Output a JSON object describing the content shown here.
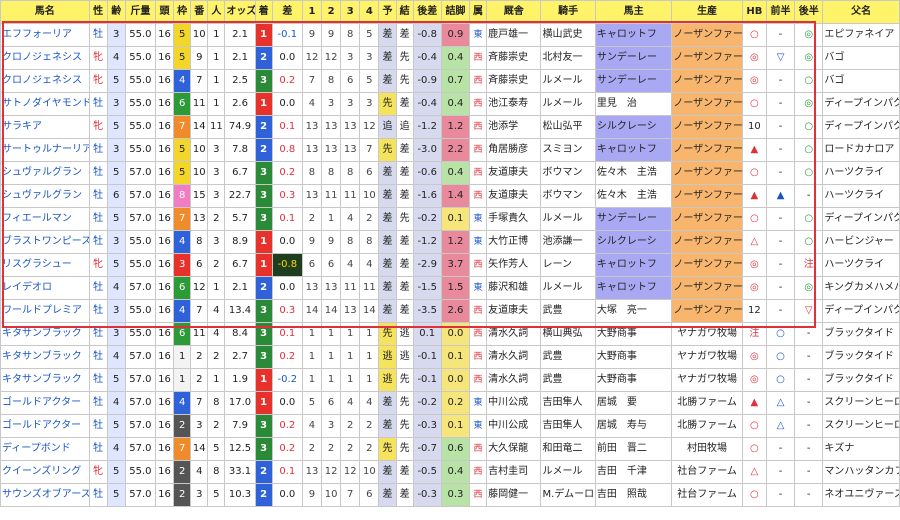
{
  "headers": [
    "馬名",
    "性",
    "齢",
    "斤量",
    "頭",
    "枠",
    "番",
    "人",
    "オッズ",
    "着",
    "差",
    "1",
    "2",
    "3",
    "4",
    "予",
    "結",
    "後差",
    "詰脚",
    "属",
    "厩舎",
    "騎手",
    "馬主",
    "生産",
    "HB",
    "前半",
    "後半",
    "父名"
  ],
  "rows": [
    [
      "エフフォーリア",
      "牡",
      "3",
      "55.0",
      "16",
      "5",
      "10",
      "1",
      "2.1",
      "1",
      "-0.1",
      "9",
      "9",
      "8",
      "5",
      "差",
      "差",
      "-0.8",
      "0.9",
      "東",
      "鹿戸雄一",
      "横山武史",
      "キャロットフ",
      "ノーザンファーム",
      "○",
      "-",
      "◎",
      "エピファネイア"
    ],
    [
      "クロノジェネシス",
      "牝",
      "4",
      "55.0",
      "16",
      "5",
      "9",
      "1",
      "2.1",
      "2",
      "0.0",
      "12",
      "12",
      "3",
      "3",
      "差",
      "先",
      "-0.4",
      "0.4",
      "西",
      "斉藤崇史",
      "北村友一",
      "サンデーレー",
      "ノーザンファーム",
      "◎",
      "▽",
      "◎",
      "バゴ"
    ],
    [
      "クロノジェネシス",
      "牝",
      "5",
      "55.0",
      "16",
      "4",
      "7",
      "1",
      "2.5",
      "3",
      "0.2",
      "7",
      "8",
      "6",
      "5",
      "差",
      "先",
      "-0.9",
      "0.7",
      "西",
      "斉藤崇史",
      "ルメール",
      "サンデーレー",
      "ノーザンファーム",
      "◎",
      "-",
      "○",
      "バゴ"
    ],
    [
      "サトノダイヤモンド",
      "牡",
      "3",
      "55.0",
      "16",
      "6",
      "11",
      "1",
      "2.6",
      "1",
      "0.0",
      "4",
      "3",
      "3",
      "3",
      "先",
      "差",
      "-0.4",
      "0.4",
      "西",
      "池江泰寿",
      "ルメール",
      "里見　治",
      "ノーザンファーム",
      "○",
      "-",
      "◎",
      "ディープインパクト"
    ],
    [
      "サラキア",
      "牝",
      "5",
      "55.0",
      "16",
      "7",
      "14",
      "11",
      "74.9",
      "2",
      "0.1",
      "13",
      "13",
      "13",
      "12",
      "追",
      "追",
      "-1.2",
      "1.2",
      "西",
      "池添学",
      "松山弘平",
      "シルクレーシ",
      "ノーザンファーム",
      "10",
      "-",
      "○",
      "ディープインパクト"
    ],
    [
      "サートゥルナーリア",
      "牡",
      "3",
      "55.0",
      "16",
      "5",
      "10",
      "3",
      "7.8",
      "2",
      "0.8",
      "13",
      "13",
      "13",
      "7",
      "先",
      "差",
      "-3.0",
      "2.2",
      "西",
      "角居勝彦",
      "スミヨン",
      "キャロットフ",
      "ノーザンファーム",
      "▲",
      "-",
      "○",
      "ロードカナロア"
    ],
    [
      "シュヴァルグラン",
      "牡",
      "5",
      "57.0",
      "16",
      "5",
      "10",
      "3",
      "6.7",
      "3",
      "0.2",
      "8",
      "8",
      "8",
      "6",
      "差",
      "差",
      "-0.6",
      "0.4",
      "西",
      "友道康夫",
      "ボウマン",
      "佐々木　主浩",
      "ノーザンファーム",
      "○",
      "-",
      "○",
      "ハーツクライ"
    ],
    [
      "シュヴァルグラン",
      "牡",
      "6",
      "57.0",
      "16",
      "8",
      "15",
      "3",
      "22.7",
      "3",
      "0.3",
      "13",
      "11",
      "11",
      "10",
      "差",
      "差",
      "-1.6",
      "1.4",
      "西",
      "友道康夫",
      "ボウマン",
      "佐々木　主浩",
      "ノーザンファーム",
      "▲",
      "▲",
      "-",
      "ハーツクライ"
    ],
    [
      "フィエールマン",
      "牡",
      "5",
      "57.0",
      "16",
      "7",
      "13",
      "2",
      "5.7",
      "3",
      "0.1",
      "2",
      "1",
      "4",
      "2",
      "差",
      "先",
      "-0.2",
      "0.1",
      "東",
      "手塚貴久",
      "ルメール",
      "サンデーレー",
      "ノーザンファーム",
      "○",
      "-",
      "○",
      "ディープインパクト"
    ],
    [
      "ブラストワンピース",
      "牡",
      "3",
      "55.0",
      "16",
      "4",
      "8",
      "3",
      "8.9",
      "1",
      "0.0",
      "9",
      "9",
      "8",
      "8",
      "差",
      "差",
      "-1.2",
      "1.2",
      "東",
      "大竹正博",
      "池添謙一",
      "シルクレーシ",
      "ノーザンファーム",
      "△",
      "-",
      "○",
      "ハービンジャー"
    ],
    [
      "リスグラシュー",
      "牝",
      "5",
      "55.0",
      "16",
      "3",
      "6",
      "2",
      "6.7",
      "1",
      "-0.8",
      "6",
      "6",
      "4",
      "4",
      "差",
      "差",
      "-2.9",
      "3.7",
      "西",
      "矢作芳人",
      "レーン",
      "キャロットフ",
      "ノーザンファーム",
      "◎",
      "-",
      "注",
      "ハーツクライ"
    ],
    [
      "レイデオロ",
      "牡",
      "4",
      "57.0",
      "16",
      "6",
      "12",
      "1",
      "2.1",
      "2",
      "0.0",
      "13",
      "13",
      "11",
      "11",
      "差",
      "差",
      "-1.5",
      "1.5",
      "東",
      "藤沢和雄",
      "ルメール",
      "キャロットフ",
      "ノーザンファーム",
      "◎",
      "-",
      "◎",
      "キングカメハメハ"
    ],
    [
      "ワールドプレミア",
      "牡",
      "3",
      "55.0",
      "16",
      "4",
      "7",
      "4",
      "13.4",
      "3",
      "0.3",
      "14",
      "14",
      "13",
      "14",
      "差",
      "差",
      "-3.5",
      "2.6",
      "西",
      "友道康夫",
      "武豊",
      "大塚　亮一",
      "ノーザンファーム",
      "12",
      "-",
      "▽",
      "ディープインパクト"
    ],
    [
      "キタサンブラック",
      "牡",
      "3",
      "55.0",
      "16",
      "6",
      "11",
      "4",
      "8.4",
      "3",
      "0.1",
      "1",
      "1",
      "1",
      "1",
      "先",
      "逃",
      "0.1",
      "0.0",
      "西",
      "清水久詞",
      "横山典弘",
      "大野商事",
      "ヤナガワ牧場",
      "注",
      "○",
      "-",
      "ブラックタイド"
    ],
    [
      "キタサンブラック",
      "牡",
      "4",
      "57.0",
      "16",
      "1",
      "2",
      "2",
      "2.7",
      "3",
      "0.2",
      "1",
      "1",
      "1",
      "1",
      "逃",
      "逃",
      "-0.1",
      "0.1",
      "西",
      "清水久詞",
      "武豊",
      "大野商事",
      "ヤナガワ牧場",
      "◎",
      "○",
      "-",
      "ブラックタイド"
    ],
    [
      "キタサンブラック",
      "牡",
      "5",
      "57.0",
      "16",
      "1",
      "2",
      "1",
      "1.9",
      "1",
      "-0.2",
      "1",
      "1",
      "1",
      "1",
      "逃",
      "先",
      "-0.1",
      "0.0",
      "西",
      "清水久詞",
      "武豊",
      "大野商事",
      "ヤナガワ牧場",
      "◎",
      "○",
      "-",
      "ブラックタイド"
    ],
    [
      "ゴールドアクター",
      "牡",
      "4",
      "57.0",
      "16",
      "4",
      "7",
      "8",
      "17.0",
      "1",
      "0.0",
      "5",
      "6",
      "4",
      "4",
      "差",
      "先",
      "-0.2",
      "0.2",
      "東",
      "中川公成",
      "吉田隼人",
      "居城　要",
      "北勝ファーム",
      "▲",
      "△",
      "-",
      "スクリーンヒーロー"
    ],
    [
      "ゴールドアクター",
      "牡",
      "5",
      "57.0",
      "16",
      "2",
      "3",
      "2",
      "7.9",
      "3",
      "0.2",
      "4",
      "3",
      "2",
      "2",
      "差",
      "先",
      "-0.3",
      "0.1",
      "東",
      "中川公成",
      "吉田隼人",
      "居城　寿与",
      "北勝ファーム",
      "○",
      "△",
      "-",
      "スクリーンヒーロー"
    ],
    [
      "ディープボンド",
      "牡",
      "4",
      "57.0",
      "16",
      "7",
      "14",
      "5",
      "12.5",
      "3",
      "0.2",
      "2",
      "2",
      "2",
      "2",
      "先",
      "先",
      "-0.7",
      "0.6",
      "西",
      "大久保龍",
      "和田竜二",
      "前田　晋二",
      "村田牧場",
      "○",
      "-",
      "-",
      "キズナ"
    ],
    [
      "クイーンズリング",
      "牝",
      "5",
      "55.0",
      "16",
      "2",
      "4",
      "8",
      "33.1",
      "2",
      "0.1",
      "13",
      "12",
      "12",
      "10",
      "差",
      "差",
      "-0.5",
      "0.4",
      "西",
      "吉村圭司",
      "ルメール",
      "吉田　千津",
      "社台ファーム",
      "△",
      "-",
      "-",
      "マンハッタンカフェ"
    ],
    [
      "サウンズオブアース",
      "牡",
      "5",
      "57.0",
      "16",
      "2",
      "3",
      "5",
      "10.3",
      "2",
      "0.0",
      "9",
      "10",
      "7",
      "6",
      "差",
      "差",
      "-0.3",
      "0.3",
      "西",
      "藤岡健一",
      "M.デムーロ",
      "吉田　照哉",
      "社台ファーム",
      "○",
      "-",
      "-",
      "ネオユニヴァース"
    ]
  ],
  "colors": {
    "highlight_frame": "#e0303a",
    "header_bg": "#fff36a"
  }
}
